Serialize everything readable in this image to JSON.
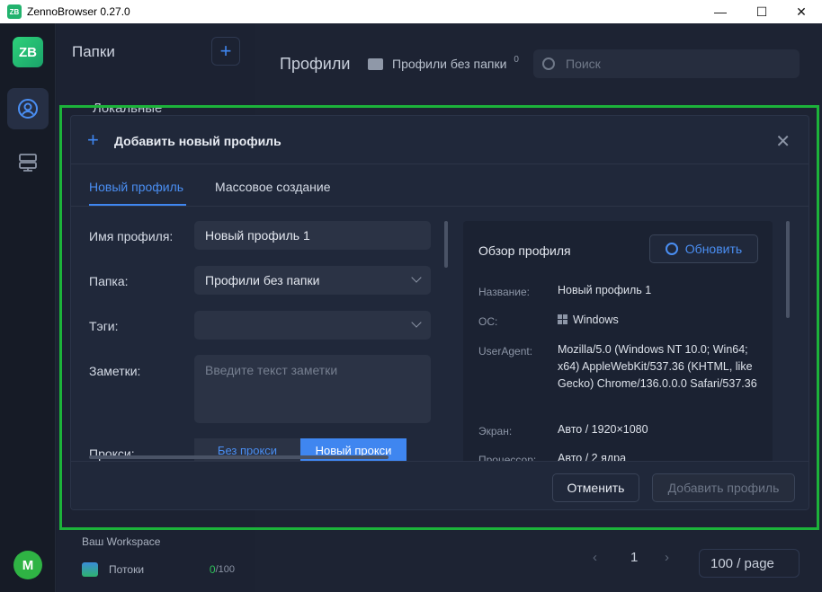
{
  "window": {
    "title": "ZennoBrowser 0.27.0",
    "logo": "ZB",
    "minimize": "—",
    "maximize": "☐",
    "close": "✕"
  },
  "rail": {
    "logo": "ZB",
    "avatar": "M"
  },
  "folders": {
    "title": "Папки",
    "add": "+",
    "local": "Локальные",
    "workspace": "Ваш Workspace",
    "streams": {
      "label": "Потоки",
      "count": "0",
      "total": "/100"
    }
  },
  "main": {
    "title": "Профили",
    "folder": "Профили без папки",
    "folder_count": "0",
    "search_placeholder": "Поиск",
    "page": "1",
    "page_prev": "‹",
    "page_next": "›",
    "page_size": "100 / page"
  },
  "modal": {
    "title": "Добавить новый профиль",
    "plus": "+",
    "close": "✕",
    "tabs": [
      "Новый профиль",
      "Массовое создание"
    ],
    "form": {
      "name_label": "Имя профиля:",
      "name_value": "Новый профиль 1",
      "folder_label": "Папка:",
      "folder_value": "Профили без папки",
      "tags_label": "Тэги:",
      "tags_value": "",
      "notes_label": "Заметки:",
      "notes_placeholder": "Введите текст заметки",
      "proxy_label": "Прокси:",
      "proxy_options": [
        "Без прокси",
        "Новый прокси"
      ]
    },
    "overview": {
      "title": "Обзор профиля",
      "refresh": "Обновить",
      "rows": [
        {
          "key": "Название:",
          "value": "Новый профиль 1"
        },
        {
          "key": "ОС:",
          "value": "Windows"
        },
        {
          "key": "UserAgent:",
          "value": "Mozilla/5.0 (Windows NT 10.0; Win64; x64) AppleWebKit/537.36 (KHTML, like Gecko) Chrome/136.0.0.0 Safari/537.36"
        },
        {
          "key": "Экран:",
          "value": "Авто / 1920×1080"
        },
        {
          "key": "Процессор:",
          "value": "Авто / 2 ядра"
        }
      ]
    },
    "cancel": "Отменить",
    "submit": "Добавить профиль"
  },
  "colors": {
    "accent": "#3f86f0",
    "highlight": "#1cb33a",
    "brand": "#22b36e"
  }
}
